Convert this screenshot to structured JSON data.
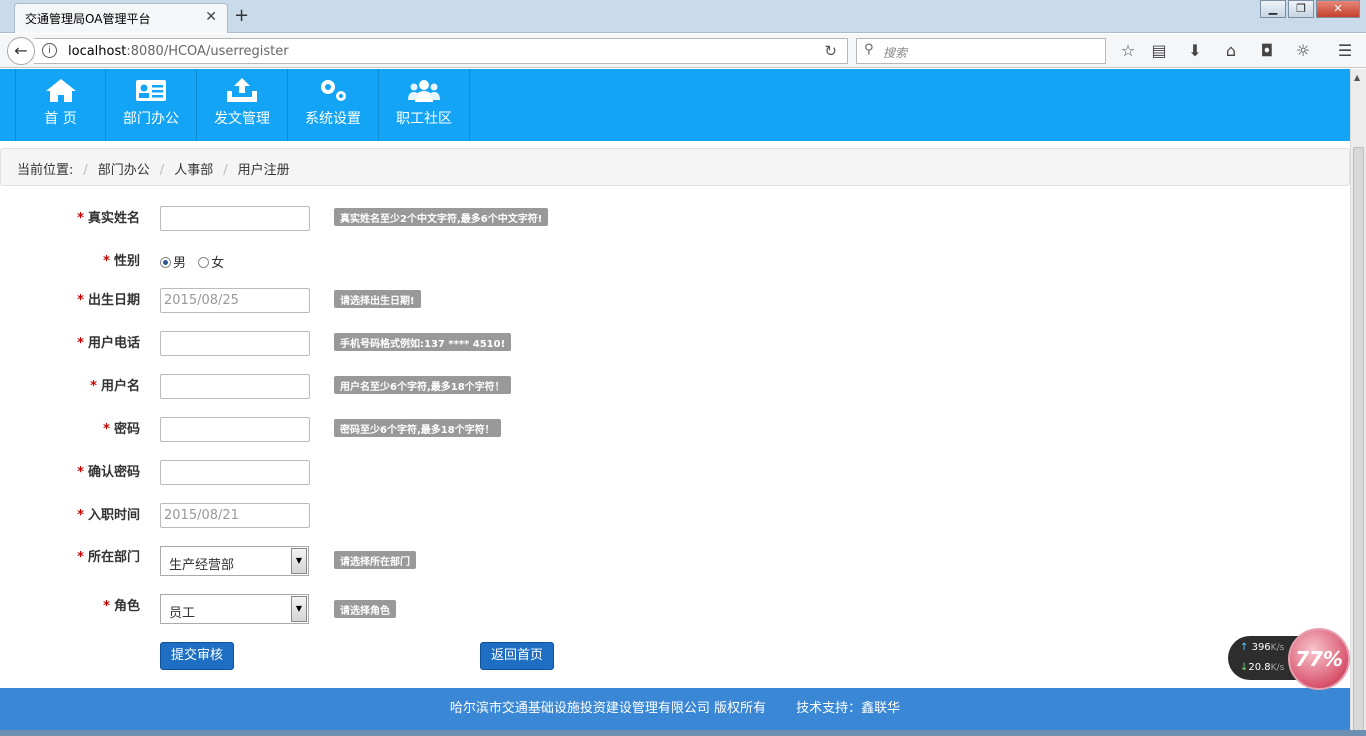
{
  "browser": {
    "tab_title": "交通管理局OA管理平台",
    "url_host": "localhost",
    "url_rest": ":8080/HCOA/userregister",
    "search_placeholder": "搜索"
  },
  "nav": [
    {
      "label": "首 页",
      "icon": "home-icon"
    },
    {
      "label": "部门办公",
      "icon": "id-card-icon"
    },
    {
      "label": "发文管理",
      "icon": "upload-tray-icon"
    },
    {
      "label": "系统设置",
      "icon": "gears-icon"
    },
    {
      "label": "职工社区",
      "icon": "users-icon"
    }
  ],
  "breadcrumb": {
    "prefix": "当前位置:",
    "items": [
      "部门办公",
      "人事部",
      "用户注册"
    ]
  },
  "form": {
    "real_name": {
      "label": "真实姓名",
      "value": "",
      "hint": "真实姓名至少2个中文字符,最多6个中文字符!"
    },
    "gender": {
      "label": "性别",
      "options": [
        "男",
        "女"
      ],
      "selected": "男"
    },
    "birth_date": {
      "label": "出生日期",
      "value": "2015/08/25",
      "hint": "请选择出生日期!"
    },
    "phone": {
      "label": "用户电话",
      "value": "",
      "hint": "手机号码格式例如:137 **** 4510!"
    },
    "username": {
      "label": "用户名",
      "value": "",
      "hint": "用户名至少6个字符,最多18个字符！"
    },
    "password": {
      "label": "密码",
      "value": "",
      "hint": "密码至少6个字符,最多18个字符！"
    },
    "confirm_password": {
      "label": "确认密码",
      "value": ""
    },
    "hire_date": {
      "label": "入职时间",
      "value": "2015/08/21"
    },
    "department": {
      "label": "所在部门",
      "value": "生产经营部",
      "hint": "请选择所在部门"
    },
    "role": {
      "label": "角色",
      "value": "员工",
      "hint": "请选择角色"
    },
    "submit_label": "提交审核",
    "back_label": "返回首页"
  },
  "footer": {
    "copyright": "哈尔滨市交通基础设施投资建设管理有限公司 版权所有",
    "support": "技术支持：鑫联华"
  },
  "speed_widget": {
    "upload": "396",
    "upload_unit": "K/s",
    "download": "20.8",
    "download_unit": "K/s",
    "percent": "77%"
  },
  "colors": {
    "header_blue": "#13a4f5",
    "button_blue": "#1e6fc4",
    "footer_blue": "#3a87d6",
    "required_red": "#cc0000"
  }
}
